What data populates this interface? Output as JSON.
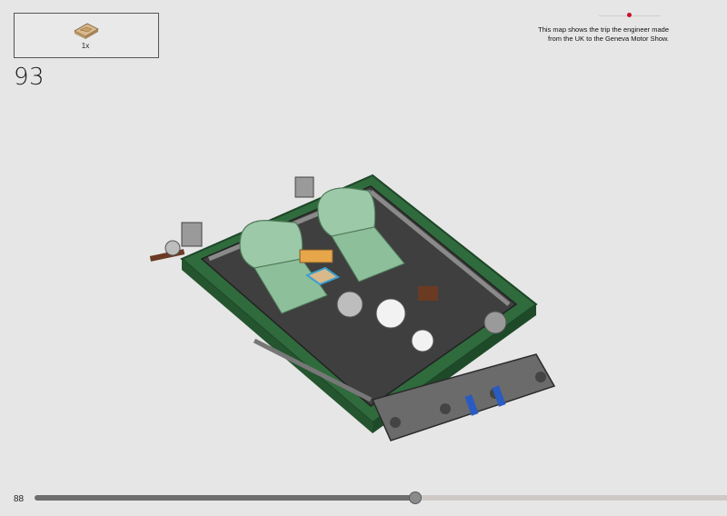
{
  "parts_list": {
    "items": [
      {
        "qty": "1x",
        "icon": "printed-tile-icon"
      }
    ]
  },
  "step": {
    "number": "93"
  },
  "note": {
    "line1": "This map shows the trip the engineer made",
    "line2": "from the UK to the Geneva Motor Show."
  },
  "page": {
    "number": "88"
  },
  "progress": {
    "fraction": 0.55
  },
  "colors": {
    "accent": "#c8102e",
    "chassis_green": "#2f6b3c",
    "seat_green": "#9cc9a8",
    "frame_gray": "#6b6b6b"
  }
}
